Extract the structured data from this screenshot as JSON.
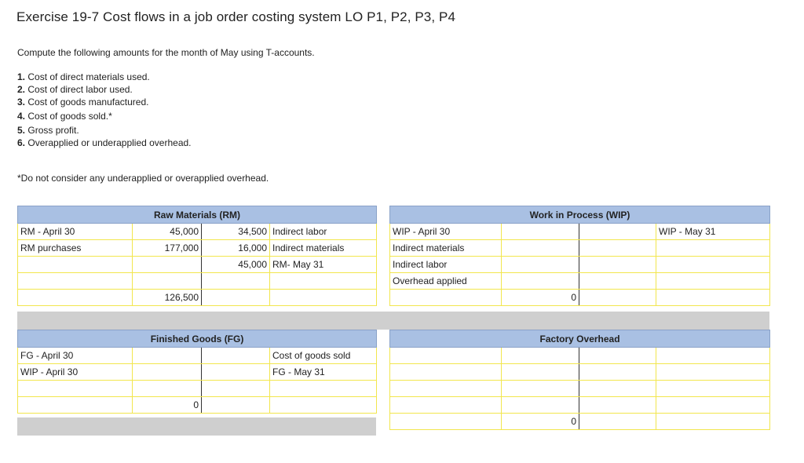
{
  "title": "Exercise 19-7 Cost flows in a job order costing system LO P1, P2, P3, P4",
  "intro": "Compute the following amounts for the month of May using T-accounts.",
  "questions": [
    {
      "num": "1.",
      "text": "Cost of direct materials used."
    },
    {
      "num": "2.",
      "text": "Cost of direct labor used."
    },
    {
      "num": "3.",
      "text": "Cost of goods manufactured."
    },
    {
      "num": "4.",
      "text": "Cost of goods sold.*"
    },
    {
      "num": "5.",
      "text": "Gross profit."
    },
    {
      "num": "6.",
      "text": "Overapplied or underapplied overhead."
    }
  ],
  "note": "*Do not consider any underapplied or overapplied overhead.",
  "accounts": {
    "raw_materials": {
      "title": "Raw Materials (RM)",
      "rows": [
        {
          "left_label": "RM - April 30",
          "debit": "45,000",
          "credit": "34,500",
          "right_label": "Indirect labor"
        },
        {
          "left_label": "RM purchases",
          "debit": "177,000",
          "credit": "16,000",
          "right_label": "Indirect materials"
        },
        {
          "left_label": "",
          "debit": "",
          "credit": "45,000",
          "right_label": "RM- May 31"
        },
        {
          "left_label": "",
          "debit": "",
          "credit": "",
          "right_label": ""
        }
      ],
      "total_debit": "126,500",
      "total_credit": ""
    },
    "work_in_process": {
      "title": "Work in Process (WIP)",
      "rows": [
        {
          "left_label": "WIP - April 30",
          "debit": "",
          "credit": "",
          "right_label": "WIP - May 31"
        },
        {
          "left_label": "Indirect materials",
          "debit": "",
          "credit": "",
          "right_label": ""
        },
        {
          "left_label": "Indirect labor",
          "debit": "",
          "credit": "",
          "right_label": ""
        },
        {
          "left_label": "Overhead applied",
          "debit": "",
          "credit": "",
          "right_label": ""
        }
      ],
      "total_debit": "0",
      "total_credit": ""
    },
    "finished_goods": {
      "title": "Finished Goods (FG)",
      "rows": [
        {
          "left_label": "FG - April 30",
          "debit": "",
          "credit": "",
          "right_label": "Cost of goods sold"
        },
        {
          "left_label": "WIP - April 30",
          "debit": "",
          "credit": "",
          "right_label": "FG - May 31"
        },
        {
          "left_label": "",
          "debit": "",
          "credit": "",
          "right_label": ""
        }
      ],
      "total_debit": "0",
      "total_credit": ""
    },
    "factory_overhead": {
      "title": "Factory Overhead",
      "rows": [
        {
          "left_label": "",
          "debit": "",
          "credit": "",
          "right_label": ""
        },
        {
          "left_label": "",
          "debit": "",
          "credit": "",
          "right_label": ""
        },
        {
          "left_label": "",
          "debit": "",
          "credit": "",
          "right_label": ""
        },
        {
          "left_label": "",
          "debit": "",
          "credit": "",
          "right_label": ""
        }
      ],
      "total_debit": "0",
      "total_credit": ""
    }
  }
}
